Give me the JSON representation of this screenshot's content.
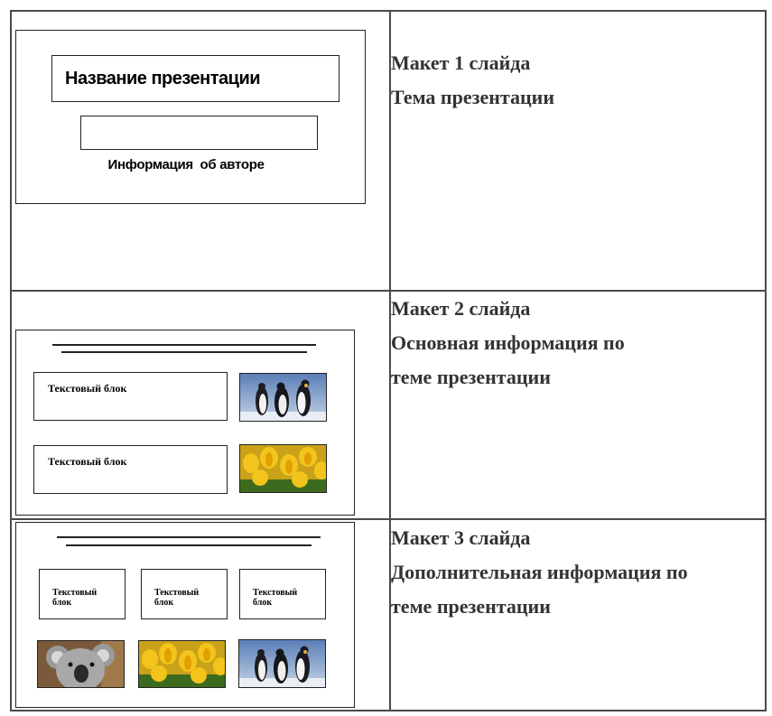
{
  "rows": [
    {
      "slide": {
        "title_box": "Название презентации",
        "author_box": "Информация  об авторе"
      },
      "description": [
        "Макет 1 слайда",
        "Тема презентации"
      ]
    },
    {
      "slide": {
        "text_boxes": [
          "Текстовый блок",
          "Текстовый блок"
        ],
        "images": [
          "penguins-photo",
          "tulips-photo"
        ]
      },
      "description": [
        "Макет 2 слайда",
        "Основная информация по",
        "теме презентации"
      ]
    },
    {
      "slide": {
        "text_boxes": [
          "Текстовый\nблок",
          "Текстовый\nблок",
          "Текстовый\nблок"
        ],
        "images": [
          "koala-photo",
          "tulips-photo",
          "penguins-photo"
        ]
      },
      "description": [
        "Макет 3 слайда",
        "Дополнительная информация по",
        "теме презентации"
      ]
    }
  ],
  "colors": {
    "border": "#4a4a4a",
    "text": "#333333"
  }
}
